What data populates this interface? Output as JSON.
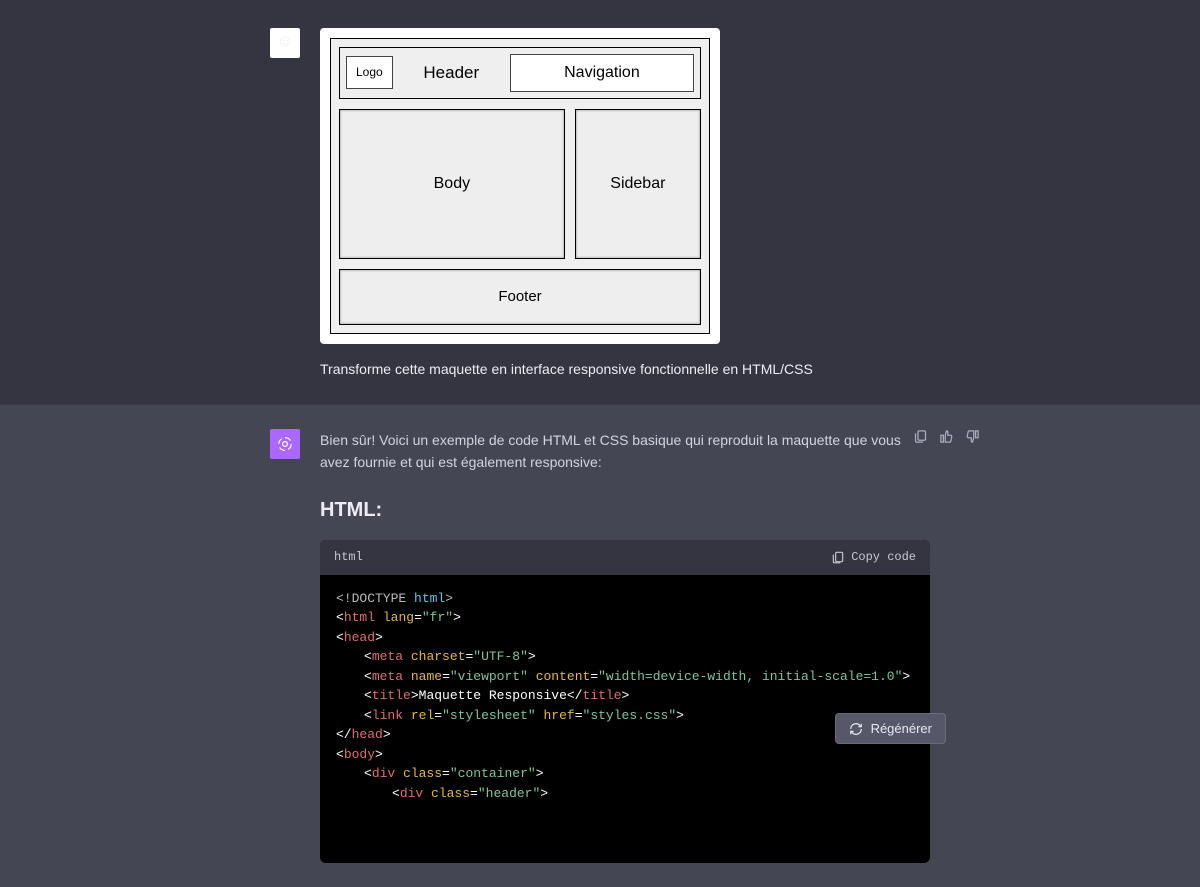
{
  "user_message": {
    "prompt_text": "Transforme cette maquette en interface responsive fonctionnelle en HTML/CSS",
    "wireframe": {
      "logo": "Logo",
      "header": "Header",
      "navigation": "Navigation",
      "body": "Body",
      "sidebar": "Sidebar",
      "footer": "Footer"
    }
  },
  "assistant_message": {
    "intro_text": "Bien sûr! Voici un exemple de code HTML et CSS basique qui reproduit la maquette que vous avez fournie et qui est également responsive:",
    "section_heading": "HTML:",
    "code_block": {
      "language": "html",
      "copy_label": "Copy code",
      "code": {
        "l1": {
          "a": "<!DOCTYPE ",
          "b": "html",
          "c": ">"
        },
        "l2": {
          "a": "<",
          "b": "html",
          "c": " ",
          "d": "lang",
          "e": "=",
          "f": "\"fr\"",
          "g": ">"
        },
        "l3": {
          "a": "<",
          "b": "head",
          "c": ">"
        },
        "l4": {
          "a": "<",
          "b": "meta",
          "c": " ",
          "d": "charset",
          "e": "=",
          "f": "\"UTF-8\"",
          "g": ">"
        },
        "l5": {
          "a": "<",
          "b": "meta",
          "c": " ",
          "d": "name",
          "e": "=",
          "f": "\"viewport\"",
          "g": " ",
          "h": "content",
          "i": "=",
          "j": "\"width=device-width, initial-scale=1.0\"",
          "k": ">"
        },
        "l6": {
          "a": "<",
          "b": "title",
          "c": ">",
          "d": "Maquette Responsive",
          "e": "</",
          "f": "title",
          "g": ">"
        },
        "l7": {
          "a": "<",
          "b": "link",
          "c": " ",
          "d": "rel",
          "e": "=",
          "f": "\"stylesheet\"",
          "g": " ",
          "h": "href",
          "i": "=",
          "j": "\"styles.css\"",
          "k": ">"
        },
        "l8": {
          "a": "</",
          "b": "head",
          "c": ">"
        },
        "l9": {
          "a": "<",
          "b": "body",
          "c": ">"
        },
        "l10": {
          "a": "<",
          "b": "div",
          "c": " ",
          "d": "class",
          "e": "=",
          "f": "\"container\"",
          "g": ">"
        },
        "l11": {
          "a": "<",
          "b": "div",
          "c": " ",
          "d": "class",
          "e": "=",
          "f": "\"header\"",
          "g": ">"
        }
      }
    }
  },
  "actions": {
    "regenerate_label": "Régénérer"
  }
}
